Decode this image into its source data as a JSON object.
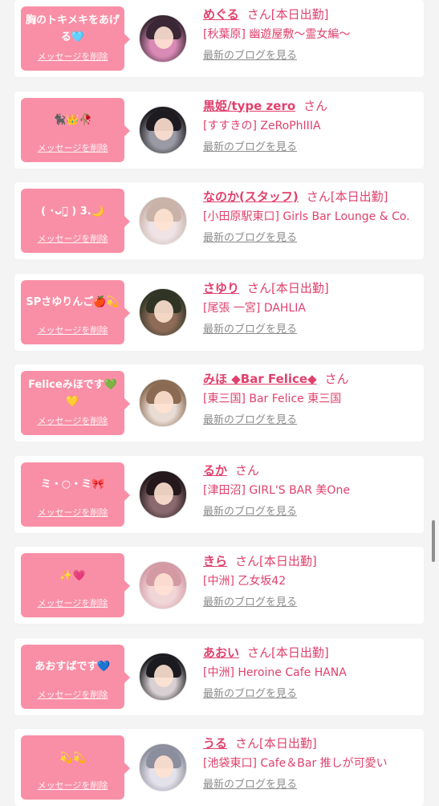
{
  "ui": {
    "delete_label": "メッセージを削除",
    "blog_label": "最新のブログを見る",
    "honorific": "さん"
  },
  "colors": {
    "bubble": "#f98fa6",
    "accent": "#e0416c",
    "link_gray": "#8c8c8c",
    "background": "#f4f4f4"
  },
  "items": [
    {
      "message": "胸のトキメキをあげる🩵",
      "name": "めぐる",
      "status": "[本日出勤]",
      "shop": "[秋葉原] 幽遊屋敷〜霊女編〜",
      "avatar_icon": "avatar-photo-icon",
      "avatar_colors": [
        "#3a2634",
        "#d98ab5"
      ]
    },
    {
      "message": "🐈‍⬛👑🥀",
      "name": "黒姫/type zero",
      "status": "",
      "shop": "[すすきの] ZeRoPhIIIA",
      "avatar_icon": "avatar-photo-icon",
      "avatar_colors": [
        "#1e1b20",
        "#9a9aa4"
      ]
    },
    {
      "message": "( ･ᴗ･̥̥̥ ) 3.🌙",
      "name": "なのか(スタッフ)",
      "status": "[本日出勤]",
      "shop": "[小田原駅東口] Girls Bar Lounge & Co.",
      "avatar_icon": "avatar-photo-icon",
      "avatar_colors": [
        "#c9b2a8",
        "#efe3e6"
      ]
    },
    {
      "message": "SPさゆりんご🍎💫",
      "name": "さゆり",
      "status": "[本日出勤]",
      "shop": "[尾張 一宮] DAHLIA",
      "avatar_icon": "avatar-photo-icon",
      "avatar_colors": [
        "#2f3424",
        "#8d6b57"
      ]
    },
    {
      "message": "Feliceみほです💚💛",
      "name": "みほ ◆Bar Felice◆",
      "status": "",
      "shop": "[東三国] Bar Felice 東三国",
      "avatar_icon": "avatar-photo-icon",
      "avatar_colors": [
        "#8a6a52",
        "#e9dcd4"
      ]
    },
    {
      "message": "ミ・○・ミ🎀",
      "name": "るか",
      "status": "",
      "shop": "[津田沼] GIRL'S BAR 美One",
      "avatar_icon": "avatar-photo-icon",
      "avatar_colors": [
        "#24181c",
        "#8a6a6e"
      ]
    },
    {
      "message": "✨💗",
      "name": "きら",
      "status": "[本日出勤]",
      "shop": "[中洲] 乙女坂42",
      "avatar_icon": "avatar-photo-icon",
      "avatar_colors": [
        "#d49aa4",
        "#f1d6d8"
      ]
    },
    {
      "message": "あおすばです💙",
      "name": "あおい",
      "status": "[本日出勤]",
      "shop": "[中洲] Heroine Cafe HANA",
      "avatar_icon": "avatar-photo-icon",
      "avatar_colors": [
        "#1a1a1f",
        "#d8d0d2"
      ]
    },
    {
      "message": "💫💫",
      "name": "うる",
      "status": "[本日出勤]",
      "shop": "[池袋東口] Cafe＆Bar 推しが可愛い",
      "avatar_icon": "avatar-photo-icon",
      "avatar_colors": [
        "#8b8e9c",
        "#e3e1ea"
      ]
    }
  ]
}
